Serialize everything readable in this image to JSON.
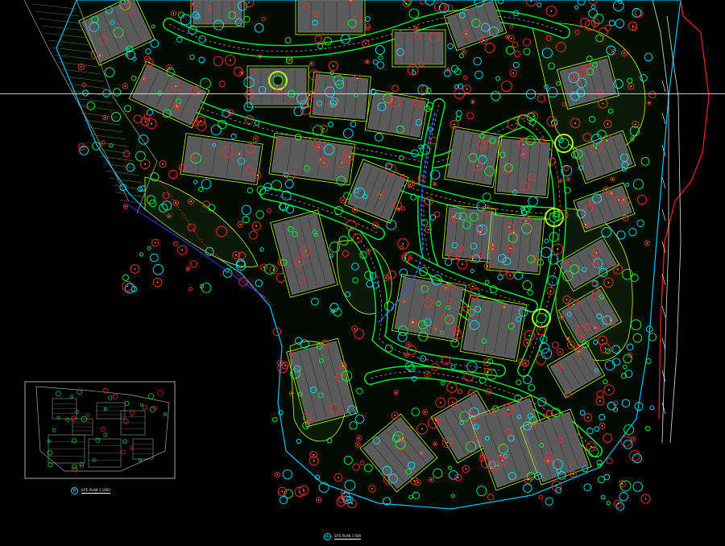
{
  "drawing": {
    "background": "#000000",
    "layer_colors": {
      "paths": "#00ff3c",
      "edges": "#b8ff1a",
      "trees": "#ff2a2a",
      "shrubs": "#00e5ff",
      "buildings": "#5a5a5a",
      "boundary": "#ff2020",
      "site_outline": "#00c8ff"
    }
  },
  "captions": {
    "main": {
      "number": "A",
      "title": "SITE PLAN 1:500"
    },
    "inset": {
      "number": "B",
      "title": "SITE PLAN 1:1000"
    }
  }
}
